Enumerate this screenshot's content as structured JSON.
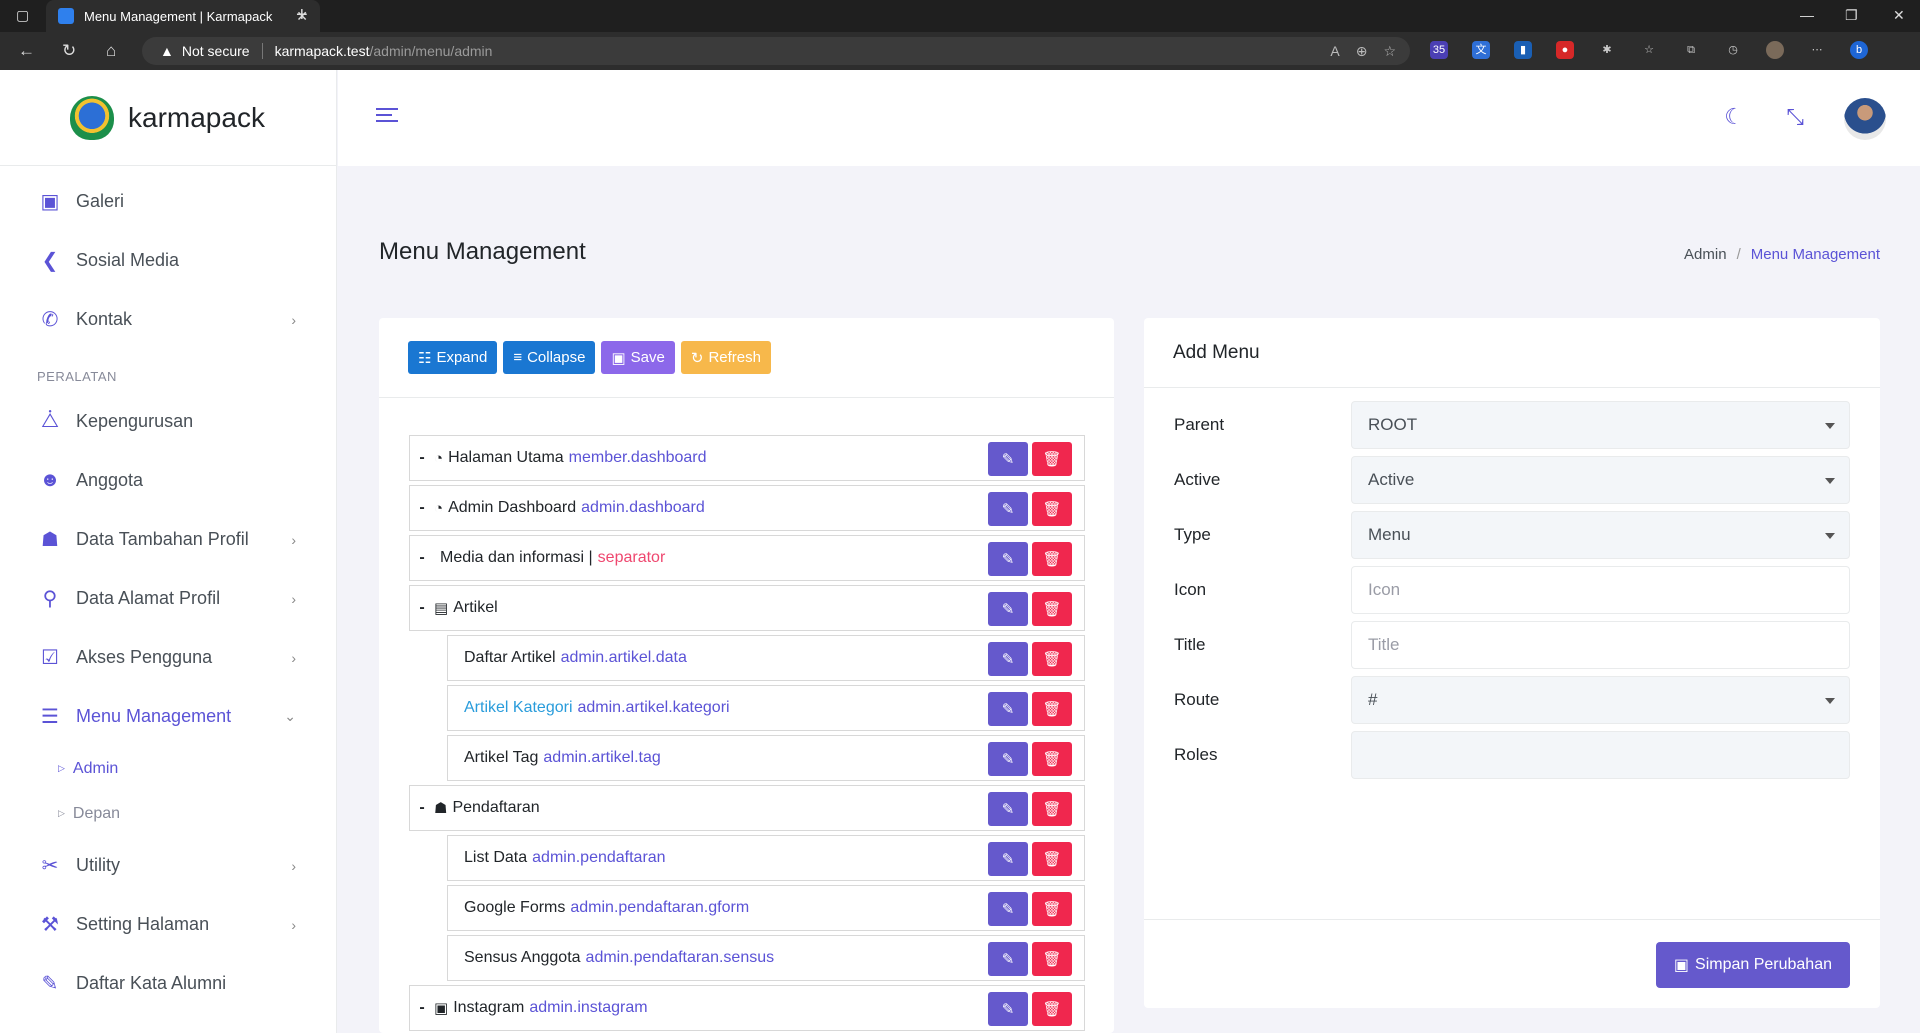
{
  "browser": {
    "tab_title": "Menu Management | Karmapack",
    "not_secure": "Not secure",
    "url_host": "karmapack.test",
    "url_path": "/admin/menu/admin",
    "ext_badge": "35"
  },
  "brand": {
    "name": "karmapack"
  },
  "sidebar": {
    "items_top": [
      {
        "label": "Galeri",
        "icon": "image-icon"
      },
      {
        "label": "Sosial Media",
        "icon": "share-icon"
      },
      {
        "label": "Kontak",
        "icon": "phone-icon",
        "arrow": "›"
      }
    ],
    "section_title": "PERALATAN",
    "items": [
      {
        "label": "Kepengurusan",
        "icon": "sitemap-icon"
      },
      {
        "label": "Anggota",
        "icon": "users-icon"
      },
      {
        "label": "Data Tambahan Profil",
        "icon": "user-icon",
        "arrow": "›"
      },
      {
        "label": "Data Alamat Profil",
        "icon": "map-pin-icon",
        "arrow": "›"
      },
      {
        "label": "Akses Pengguna",
        "icon": "user-check-icon",
        "arrow": "›"
      },
      {
        "label": "Menu Management",
        "icon": "bars-icon",
        "arrow": "⌄"
      }
    ],
    "submenu": [
      {
        "label": "Admin"
      },
      {
        "label": "Depan"
      }
    ],
    "items_bottom": [
      {
        "label": "Utility",
        "icon": "tools-icon",
        "arrow": "›"
      },
      {
        "label": "Setting Halaman",
        "icon": "wrench-icon",
        "arrow": "›"
      },
      {
        "label": "Daftar Kata Alumni",
        "icon": "user-edit-icon"
      }
    ]
  },
  "page": {
    "title": "Menu Management",
    "breadcrumb": {
      "root": "Admin",
      "sep": "/",
      "current": "Menu Management"
    }
  },
  "toolbar": {
    "expand": "Expand",
    "collapse": "Collapse",
    "save": "Save",
    "refresh": "Refresh"
  },
  "tree": [
    {
      "toggle": "-",
      "icon": "gauge-icon",
      "text": "Halaman Utama",
      "route": "member.dashboard",
      "child": false
    },
    {
      "toggle": "-",
      "icon": "gauge-icon",
      "text": "Admin Dashboard",
      "route": "admin.dashboard",
      "child": false
    },
    {
      "toggle": "-",
      "text": "Media dan informasi |",
      "route": "separator",
      "child": false,
      "route_red": true
    },
    {
      "toggle": "-",
      "icon": "file-icon",
      "text": "Artikel",
      "route": "",
      "child": false
    },
    {
      "text": "Daftar Artikel",
      "route": "admin.artikel.data",
      "child": true
    },
    {
      "text": "Artikel Kategori",
      "route": "admin.artikel.kategori",
      "child": true,
      "text_blue": true
    },
    {
      "text": "Artikel Tag",
      "route": "admin.artikel.tag",
      "child": true
    },
    {
      "toggle": "-",
      "icon": "user-plus-icon",
      "text": "Pendaftaran",
      "route": "",
      "child": false
    },
    {
      "text": "List Data",
      "route": "admin.pendaftaran",
      "child": true
    },
    {
      "text": "Google Forms",
      "route": "admin.pendaftaran.gform",
      "child": true
    },
    {
      "text": "Sensus Anggota",
      "route": "admin.pendaftaran.sensus",
      "child": true
    },
    {
      "toggle": "-",
      "icon": "image-icon",
      "text": "Instagram",
      "route": "admin.instagram",
      "child": false
    }
  ],
  "form": {
    "title": "Add Menu",
    "fields": [
      {
        "label": "Parent",
        "value": "ROOT",
        "kind": "select"
      },
      {
        "label": "Active",
        "value": "Active",
        "kind": "select"
      },
      {
        "label": "Type",
        "value": "Menu",
        "kind": "select"
      },
      {
        "label": "Icon",
        "placeholder": "Icon",
        "kind": "input"
      },
      {
        "label": "Title",
        "placeholder": "Title",
        "kind": "input"
      },
      {
        "label": "Route",
        "value": "#",
        "kind": "select"
      },
      {
        "label": "Roles",
        "value": "",
        "kind": "multi"
      }
    ],
    "submit": "Simpan Perubahan"
  },
  "colors": {
    "primary": "#5b53d6",
    "edit": "#6559cc",
    "delete": "#f0274e",
    "blue_btn": "#1a77d2",
    "yellow_btn": "#f7b84b"
  }
}
